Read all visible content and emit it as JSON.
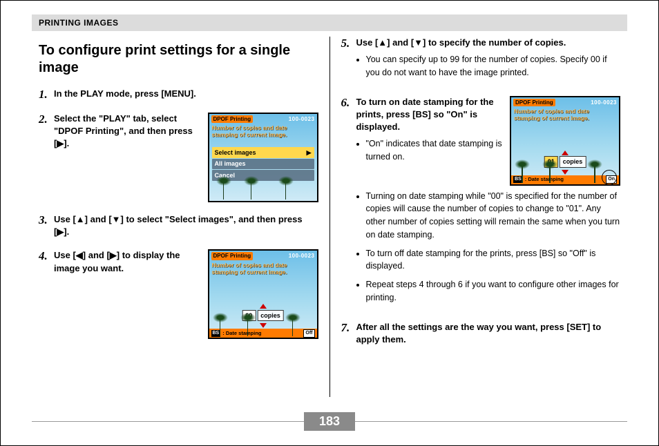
{
  "header": {
    "title": "PRINTING IMAGES"
  },
  "section_title": "To configure print settings for a single image",
  "steps": {
    "s1": {
      "num": "1.",
      "text": "In the PLAY mode, press [MENU]."
    },
    "s2": {
      "num": "2.",
      "text": "Select the \"PLAY\" tab, select \"DPOF Printing\", and then press [▶]."
    },
    "s3": {
      "num": "3.",
      "text": "Use [▲] and [▼] to select \"Select images\", and then press [▶]."
    },
    "s4": {
      "num": "4.",
      "text": "Use [◀] and [▶] to display the image you want."
    },
    "s5": {
      "num": "5.",
      "text": "Use [▲] and [▼] to specify the number of copies.",
      "bullets": [
        "You can specify up to 99 for the number of copies. Specify 00 if you do not want to have the image printed."
      ]
    },
    "s6": {
      "num": "6.",
      "text": "To turn on date stamping for the prints, press [BS] so \"On\" is displayed.",
      "bullets": [
        "\"On\" indicates that date stamping is turned on.",
        "Turning on date stamping while \"00\" is specified for the number of copies will cause the number of copies to change to \"01\". Any other number of copies setting will remain the same when you turn on date stamping.",
        "To turn off date stamping for the prints, press [BS] so \"Off\" is displayed.",
        "Repeat steps 4 through 6 if you want to configure other images for printing."
      ]
    },
    "s7": {
      "num": "7.",
      "text": "After all the settings are the way you want, press [SET] to apply them."
    }
  },
  "lcd": {
    "dpof_label": "DPOF Printing",
    "img_id": "100-0023",
    "msg_two": "Number of copies and date stamping of current image.",
    "menu": {
      "select": "Select images",
      "all": "All images",
      "cancel": "Cancel",
      "arrow": "▶"
    },
    "copies_label": "copies",
    "bs": "BS",
    "stamp_label": ": Date stamping",
    "count00": "00",
    "count01": "01",
    "off": "Off",
    "on": "On"
  },
  "page_number": "183"
}
